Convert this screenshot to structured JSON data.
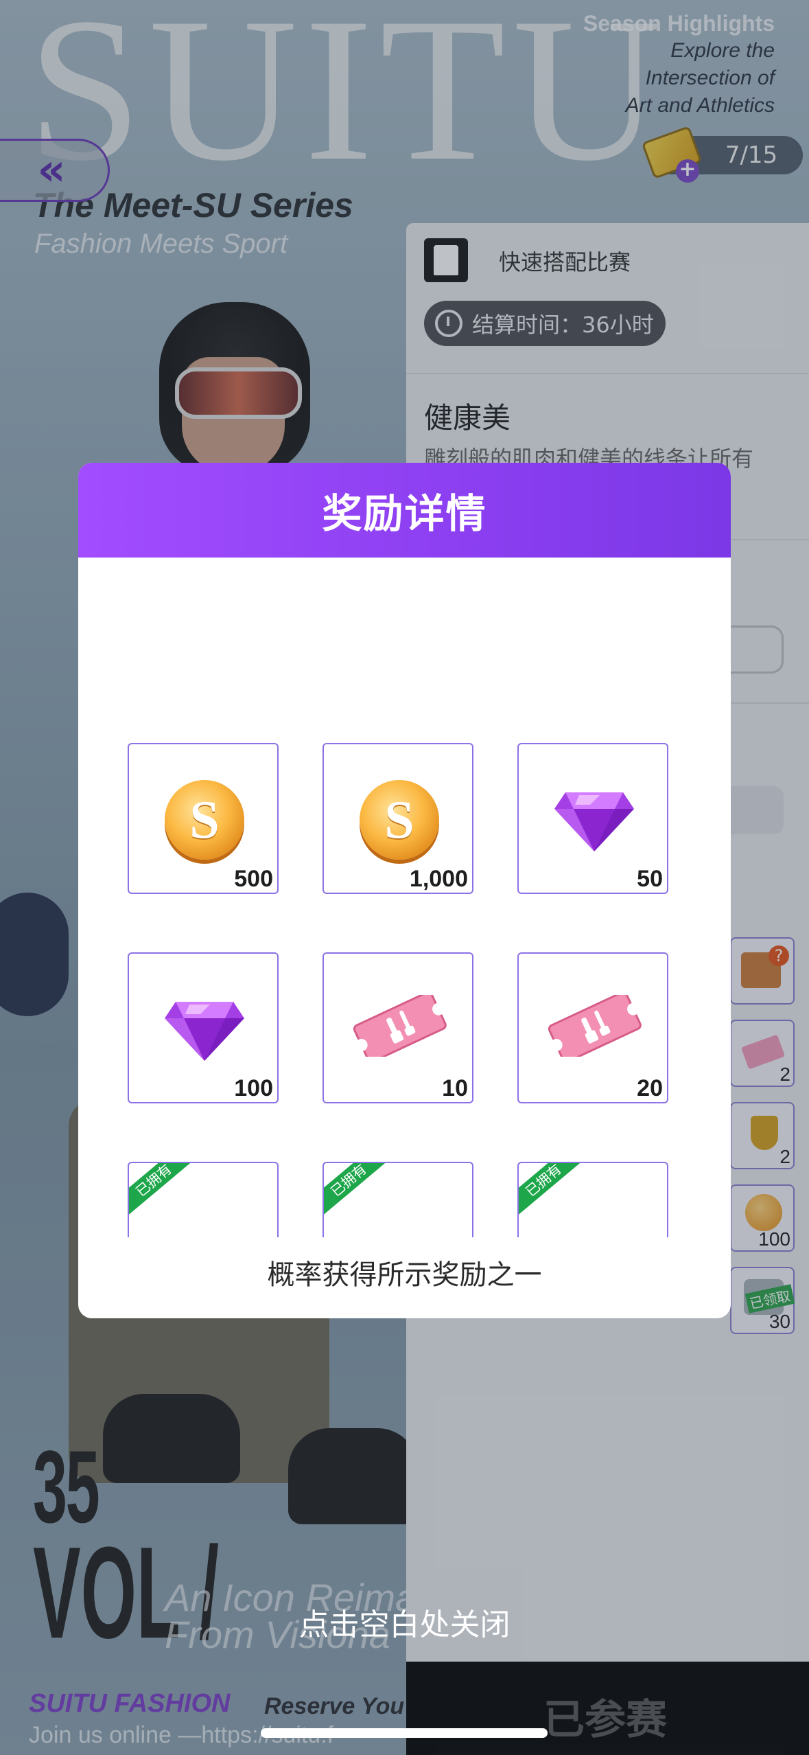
{
  "background": {
    "brand_word": "SUITU",
    "season_heading": "Season Highlights",
    "season_line1": "Explore the",
    "season_line2": "Intersection of",
    "season_line3": "Art and Athletics",
    "series_title": "The Meet-SU Series",
    "series_subtitle": "Fashion Meets Sport",
    "vol_number": "35",
    "vol_label": "VOL /",
    "tagline_line1": "An Icon Reima",
    "tagline_line2": "From Visiona",
    "footer_brand": "SUITU FASHION",
    "footer_reserve": "Reserve You",
    "footer_join": "Join us online —https://suitu.f"
  },
  "nav": {
    "back_icon": "double-chevron-left-icon",
    "back_glyph": "«"
  },
  "ticket": {
    "count": "7/15",
    "plus_glyph": "+"
  },
  "panel": {
    "contest_title": "快速搭配比赛",
    "settle_time": "结算时间：36小时",
    "theme_title": "健康美",
    "theme_desc": "雕刻般的肌肉和健美的线条让所有",
    "side_items": [
      {
        "icon": "gift-box-icon",
        "count": "",
        "badge": "?"
      },
      {
        "icon": "pink-ticket-icon",
        "count": "2"
      },
      {
        "icon": "trophy-icon",
        "count": "2"
      },
      {
        "icon": "coin-icon",
        "count": "100"
      },
      {
        "icon": "bucket-icon",
        "count": "30",
        "stamp": "已领取"
      }
    ],
    "joined_label": "已参赛"
  },
  "modal": {
    "title": "奖励详情",
    "rewards": [
      {
        "icon": "coin-icon",
        "glyph": "S",
        "quantity": "500"
      },
      {
        "icon": "coin-icon",
        "glyph": "S",
        "quantity": "1,000"
      },
      {
        "icon": "purple-gem-icon",
        "quantity": "50"
      },
      {
        "icon": "purple-gem-icon",
        "quantity": "100"
      },
      {
        "icon": "pink-ticket-icon",
        "quantity": "10"
      },
      {
        "icon": "pink-ticket-icon",
        "quantity": "20"
      },
      {
        "icon": "owned-item-icon",
        "tag": "已拥有",
        "quantity": ""
      },
      {
        "icon": "owned-item-icon",
        "tag": "已拥有",
        "quantity": ""
      },
      {
        "icon": "owned-item-icon",
        "tag": "已拥有",
        "quantity": ""
      }
    ],
    "hint": "概率获得所示奖励之一"
  },
  "close_hint": "点击空白处关闭",
  "colors": {
    "modal_header_start": "#a24dff",
    "modal_header_end": "#7c38e6",
    "cell_border": "#8c72e6",
    "owned_tag": "#1ea64a"
  }
}
